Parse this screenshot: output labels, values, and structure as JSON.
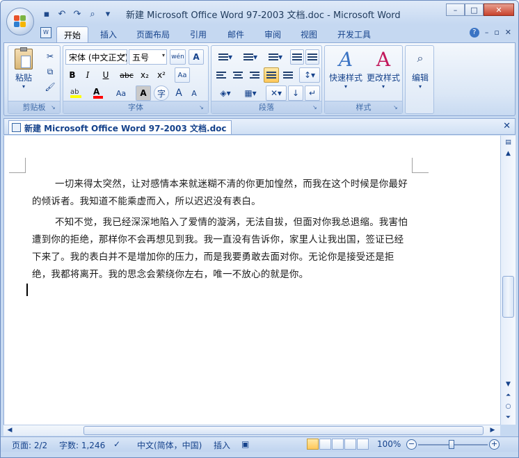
{
  "window": {
    "title": "新建 Microsoft Office Word 97-2003 文档.doc - Microsoft Word",
    "controls": [
      "–",
      "□",
      "✕"
    ]
  },
  "qat": [
    "save-icon",
    "undo-icon",
    "redo-icon",
    "print-preview-icon",
    "customize-icon"
  ],
  "tabs": [
    "开始",
    "插入",
    "页面布局",
    "引用",
    "邮件",
    "审阅",
    "视图",
    "开发工具"
  ],
  "ribbon": {
    "clipboard": {
      "label": "剪贴板",
      "paste": "粘贴"
    },
    "font": {
      "label": "字体",
      "font_name": "宋体 (中文正文)",
      "font_size": "五号",
      "wen": "wén",
      "A": "A",
      "bold": "B",
      "italic": "I",
      "underline": "U",
      "strike": "abc",
      "sub": "x₂",
      "sup": "x²",
      "aa": "Aa",
      "grow": "A",
      "shrink": "A",
      "circle": "字"
    },
    "paragraph": {
      "label": "段落"
    },
    "styles": {
      "label": "样式",
      "quick": "快速样式",
      "change": "更改样式"
    },
    "editing": {
      "label": "编辑"
    }
  },
  "doc_tab": {
    "title": "新建 Microsoft Office Word 97-2003 文档.doc"
  },
  "document": {
    "paragraphs": [
      "一切来得太突然，让对感情本来就迷糊不清的你更加惶然，而我在这个时候是你最好的倾诉者。我知道不能乘虚而入，所以迟迟没有表白。",
      "不知不觉，我已经深深地陷入了爱情的漩涡，无法自拔，但面对你我总退缩。我害怕遭到你的拒绝，那样你不会再想见到我。我一直没有告诉你，家里人让我出国，签证已经下来了。我的表白并不是增加你的压力，而是我要勇敢去面对你。无论你是接受还是拒绝，我都将离开。我的思念会萦绕你左右，唯一不放心的就是你。"
    ]
  },
  "status": {
    "page": "页面: 2/2",
    "words": "字数: 1,246",
    "language": "中文(简体，中国)",
    "insert": "插入",
    "zoom": "100%",
    "zoom_level": 1.0
  },
  "colors": {
    "highlight": "#ffff00",
    "font_color": "#ff0000",
    "ribbon_text": "#15428b"
  }
}
